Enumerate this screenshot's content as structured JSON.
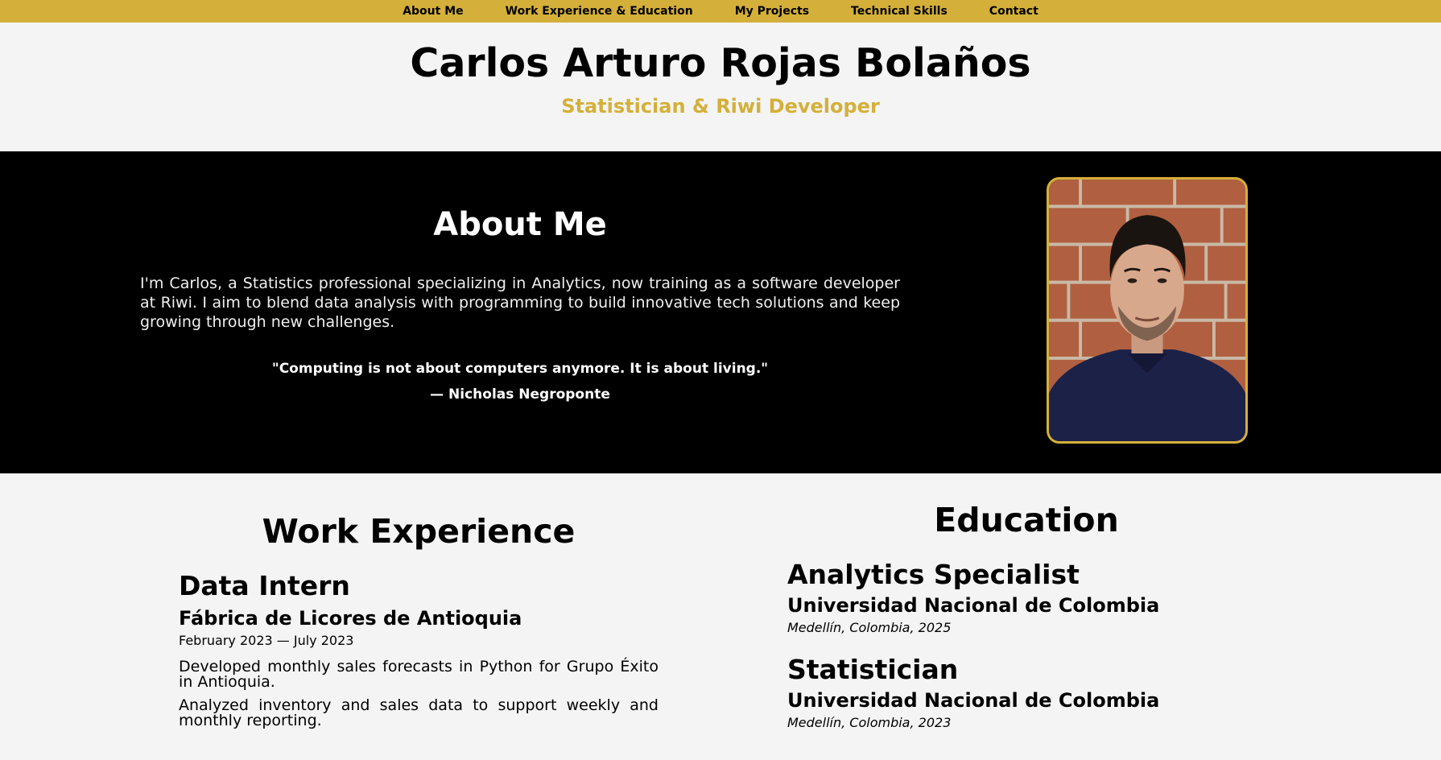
{
  "nav": {
    "items": [
      "About Me",
      "Work Experience & Education",
      "My Projects",
      "Technical Skills",
      "Contact"
    ]
  },
  "header": {
    "name": "Carlos Arturo Rojas Bolaños",
    "role": "Statistician & Riwi Developer"
  },
  "about": {
    "title": "About Me",
    "bio": "I'm Carlos, a Statistics professional specializing in Analytics, now training as a software developer at Riwi. I aim to blend data analysis with programming to build innovative tech solutions and keep growing through new challenges.",
    "quote": "\"Computing is not about computers anymore. It is about living.\"",
    "author": "— Nicholas Negroponte"
  },
  "work": {
    "title": "Work Experience",
    "jobs": [
      {
        "position": "Data Intern",
        "company": "Fábrica de Licores de Antioquia",
        "dates": "February 2023 — July 2023",
        "duties": [
          "Developed monthly sales forecasts in Python for Grupo Éxito in Antioquia.",
          "Analyzed inventory and sales data to support weekly and monthly reporting."
        ]
      }
    ]
  },
  "education": {
    "title": "Education",
    "items": [
      {
        "degree": "Analytics Specialist",
        "school": "Universidad Nacional de Colombia",
        "place": "Medellín, Colombia, 2025"
      },
      {
        "degree": "Statistician",
        "school": "Universidad Nacional de Colombia",
        "place": "Medellín, Colombia, 2023"
      }
    ]
  },
  "colors": {
    "accent": "#d4b03a",
    "dark": "#000000",
    "light": "#f4f4f4"
  }
}
